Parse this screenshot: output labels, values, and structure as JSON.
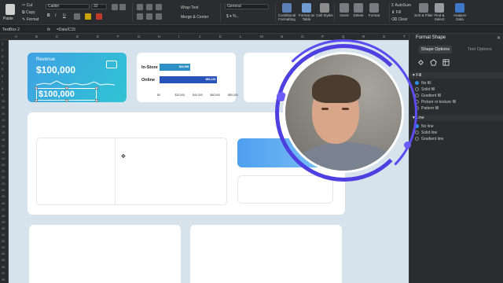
{
  "ribbon": {
    "paste": "Paste",
    "cut": "Cut",
    "copy": "Copy",
    "format": "Format",
    "font": "Calibri",
    "font_size": "32",
    "wrap_text": "Wrap Text",
    "merge_center": "Merge & Center",
    "number_format": "General",
    "conditional_formatting": "Conditional Formatting",
    "format_as_table": "Format as Table",
    "cell_styles": "Cell Styles",
    "insert": "Insert",
    "delete": "Delete",
    "format_cells": "Format",
    "autosum": "AutoSum",
    "fill": "Fill",
    "clear": "Clear",
    "sort_filter": "Sort & Filter",
    "find_select": "Find & Select",
    "analyze_data": "Analyze Data"
  },
  "formula_bar": {
    "name_box": "TextBox 2",
    "fx": "fx",
    "formula": "=Data!C15"
  },
  "columns": [
    "A",
    "B",
    "C",
    "D",
    "E",
    "F",
    "G",
    "H",
    "I",
    "J",
    "K",
    "L",
    "M",
    "N",
    "O",
    "P",
    "Q",
    "R",
    "S",
    "T"
  ],
  "rows": [
    "1",
    "2",
    "3",
    "4",
    "5",
    "6",
    "7",
    "8",
    "9",
    "10",
    "11",
    "12",
    "13",
    "14",
    "15",
    "16",
    "17",
    "18",
    "19",
    "20",
    "21",
    "22",
    "23",
    "24",
    "25",
    "26",
    "27",
    "28",
    "29",
    "30",
    "31",
    "32",
    "33",
    "34",
    "35",
    "36",
    "37",
    "38"
  ],
  "revenue_card": {
    "title": "Revenue",
    "value": "$100,000",
    "textbox_value": "$100,000"
  },
  "chart_data": {
    "type": "bar",
    "orientation": "horizontal",
    "categories": [
      "In-Store",
      "Online"
    ],
    "values": [
      34998,
      65128
    ],
    "data_labels": [
      "$34,998",
      "$65,128"
    ],
    "xlim": [
      0,
      80000
    ],
    "ticks": [
      "$0",
      "$20,000",
      "$40,000",
      "$60,000",
      "$80,000"
    ],
    "colors": [
      "#2e8fc4",
      "#2853b8"
    ]
  },
  "panel": {
    "title": "Format Shape",
    "tab_shape": "Shape Options",
    "tab_text": "Text Options",
    "fill_section": "Fill",
    "fill_options": [
      "No fill",
      "Solid fill",
      "Gradient fill",
      "Picture or texture fill",
      "Pattern fill"
    ],
    "line_section": "Line",
    "line_options": [
      "No line",
      "Solid line",
      "Gradient line"
    ]
  }
}
